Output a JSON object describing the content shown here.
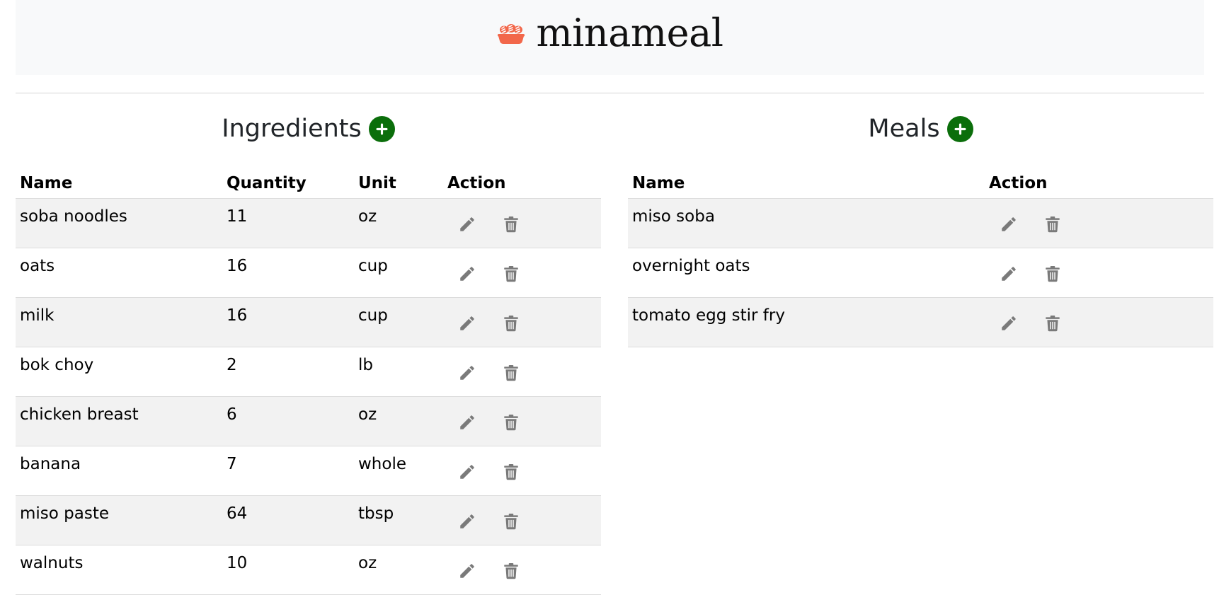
{
  "app": {
    "name": "minameal",
    "logo_icon": "bread-basket-icon",
    "logo_color": "#f2674a"
  },
  "ingredients": {
    "title": "Ingredients",
    "add_icon": "plus-circle-icon",
    "columns": [
      "Name",
      "Quantity",
      "Unit",
      "Action"
    ],
    "rows": [
      {
        "name": "soba noodles",
        "quantity": "11",
        "unit": "oz"
      },
      {
        "name": "oats",
        "quantity": "16",
        "unit": "cup"
      },
      {
        "name": "milk",
        "quantity": "16",
        "unit": "cup"
      },
      {
        "name": "bok choy",
        "quantity": "2",
        "unit": "lb"
      },
      {
        "name": "chicken breast",
        "quantity": "6",
        "unit": "oz"
      },
      {
        "name": "banana",
        "quantity": "7",
        "unit": "whole"
      },
      {
        "name": "miso paste",
        "quantity": "64",
        "unit": "tbsp"
      },
      {
        "name": "walnuts",
        "quantity": "10",
        "unit": "oz"
      }
    ]
  },
  "meals": {
    "title": "Meals",
    "add_icon": "plus-circle-icon",
    "columns": [
      "Name",
      "Action"
    ],
    "rows": [
      {
        "name": "miso soba"
      },
      {
        "name": "overnight oats"
      },
      {
        "name": "tomato egg stir fry"
      }
    ]
  },
  "colors": {
    "accent_green": "#0b6e0b",
    "icon_gray": "#7a7a7a",
    "row_stripe": "#f2f2f2",
    "header_bg": "#f8f9fa"
  }
}
